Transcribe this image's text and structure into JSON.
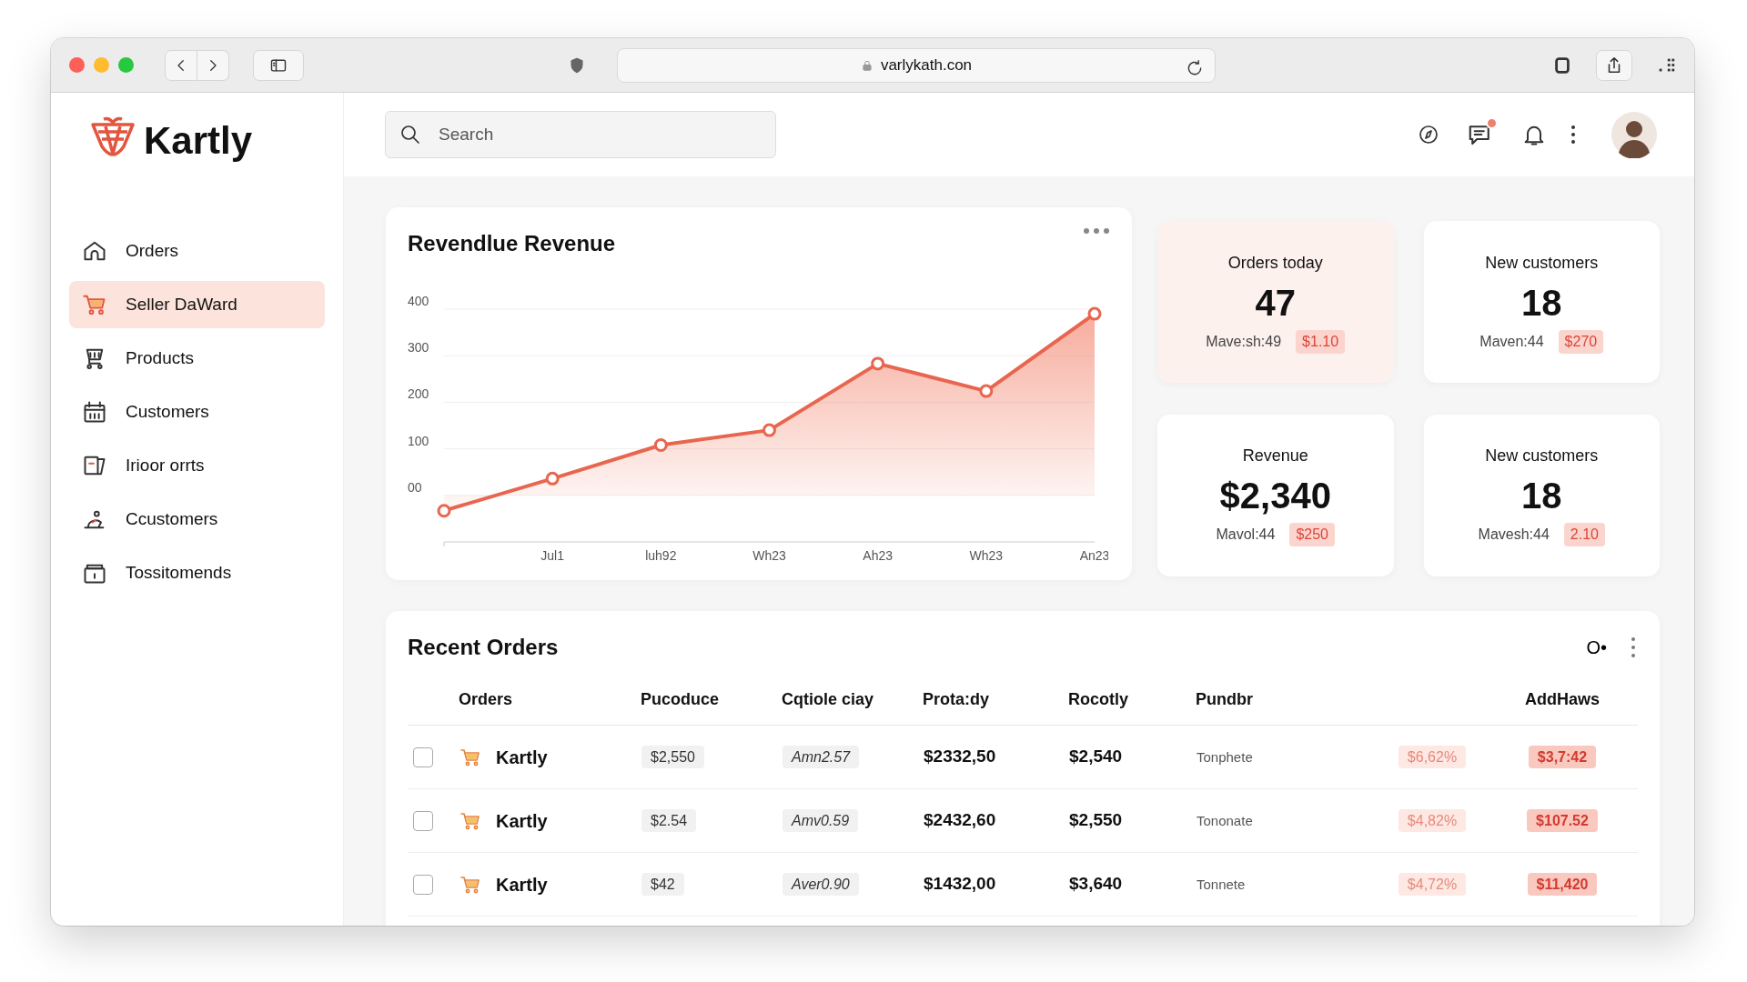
{
  "browser": {
    "url": "varlykath.con"
  },
  "brand": {
    "name": "Kartly"
  },
  "search": {
    "placeholder": "Search"
  },
  "header": {
    "messages_unread": true
  },
  "sidebar": {
    "items": [
      {
        "label": "Orders",
        "selected": false
      },
      {
        "label": "Seller DaWard",
        "selected": true
      },
      {
        "label": "Products",
        "selected": false
      },
      {
        "label": "Customers",
        "selected": false
      },
      {
        "label": "Irioor orrts",
        "selected": false
      },
      {
        "label": "Ccustomers",
        "selected": false
      },
      {
        "label": "Tossitomends",
        "selected": false
      }
    ]
  },
  "revenue_chart": {
    "title": "Revendlue Revenue",
    "chart_data": {
      "type": "area",
      "categories": [
        null,
        "Jul1",
        "luh92",
        "Wh23",
        "Ah23",
        "Wh23",
        "An23"
      ],
      "ylim": [
        -100,
        400
      ],
      "grid": true,
      "series": [
        {
          "color": "#e8664f",
          "values": [
            -33,
            36,
            108,
            140,
            283,
            224,
            390
          ]
        }
      ],
      "yticks": [
        {
          "value": 0,
          "label": "00"
        },
        100,
        200,
        300,
        400
      ]
    }
  },
  "stats": [
    {
      "label": "Orders today",
      "value": "47",
      "note": "Mave:sh:49",
      "delta": "$1.10",
      "highlighted": true
    },
    {
      "label": "New customers",
      "value": "18",
      "note": "Maven:44",
      "delta": "$270",
      "highlighted": false
    },
    {
      "label": "Revenue",
      "value": "$2,340",
      "note": "Mavol:44",
      "delta": "$250",
      "highlighted": false
    },
    {
      "label": "New customers",
      "value": "18",
      "note": "Mavesh:44",
      "delta": "2.10",
      "highlighted": false
    }
  ],
  "recent_orders": {
    "title": "Recent Orders",
    "control": "O•",
    "columns": [
      "Orders",
      "Pucoduce",
      "Cqtiole ciay",
      "Prota:dy",
      "Rocotly",
      "Pundbr",
      "",
      "AddHaws"
    ],
    "rows": [
      {
        "checked": false,
        "cells": [
          "Kartly",
          "$2,550",
          "Amn2.57",
          "$2332,50",
          "$2,540",
          "Tonphete",
          "$6,62%",
          "$3,7:42"
        ]
      },
      {
        "checked": false,
        "cells": [
          "Kartly",
          "$2.54",
          "Amv0.59",
          "$2432,60",
          "$2,550",
          "Tononate",
          "$4,82%",
          "$107.52"
        ]
      },
      {
        "checked": false,
        "cells": [
          "Kartly",
          "$42",
          "Aver0.90",
          "$1432,00",
          "$3,640",
          "Tonnete",
          "$4,72%",
          "$11,420"
        ]
      }
    ]
  }
}
